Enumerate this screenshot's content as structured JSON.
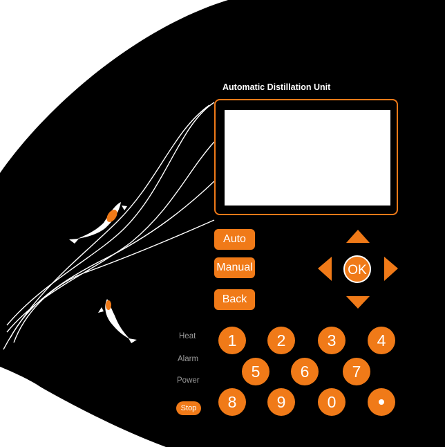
{
  "device": {
    "title": "Automatic Distillation Unit",
    "accent_color": "#f07a18",
    "panel_color": "#000000"
  },
  "mode_buttons": {
    "auto": "Auto",
    "manual": "Manual",
    "back": "Back"
  },
  "navigation": {
    "ok": "OK",
    "up_icon": "triangle-up-icon",
    "down_icon": "triangle-down-icon",
    "left_icon": "triangle-left-icon",
    "right_icon": "triangle-right-icon"
  },
  "indicators": {
    "heat": "Heat",
    "alarm": "Alarm",
    "power": "Power",
    "stop": "Stop"
  },
  "keypad": {
    "k1": "1",
    "k2": "2",
    "k3": "3",
    "k4": "4",
    "k5": "5",
    "k6": "6",
    "k7": "7",
    "k8": "8",
    "k9": "9",
    "k0": "0",
    "dot_icon": "dot-icon"
  }
}
